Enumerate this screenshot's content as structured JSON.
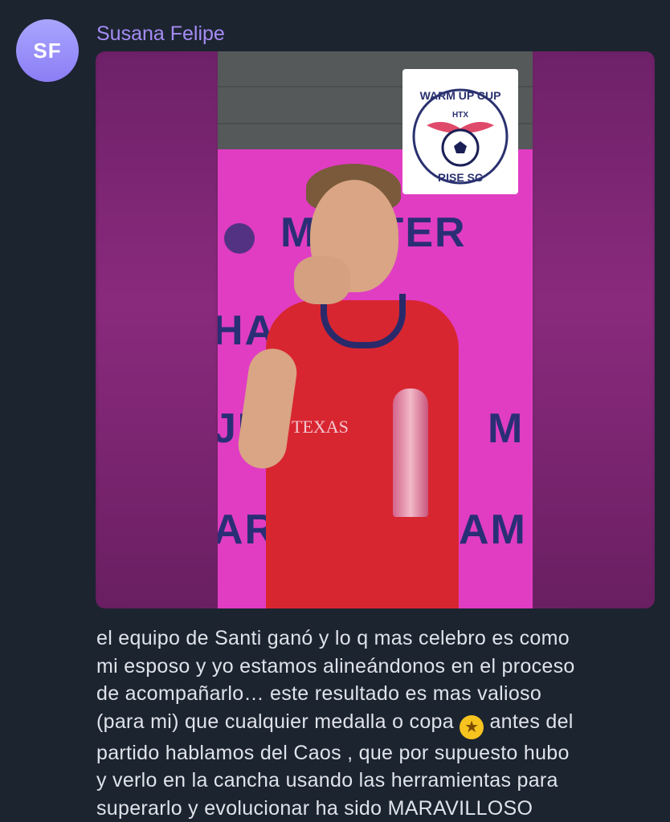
{
  "message": {
    "sender_initials": "SF",
    "sender_name": "Susana Felipe",
    "photo": {
      "logo_text_top": "WARM UP CUP",
      "logo_text_mid": "HTX",
      "logo_text_bottom": "RISE SC",
      "backdrop_words": [
        "MASTER",
        "HAMPIONS",
        "JU",
        "M",
        "AR",
        "AM"
      ],
      "sponsor_text": "TEXAS"
    },
    "text_line1": "el equipo de Santi ganó y lo q mas celebro es como",
    "text_line2": "mi esposo y yo estamos alineándonos en el proceso",
    "text_line3": "de acompañarlo… este resultado es mas valioso",
    "text_line4a": "(para mi) que cualquier medalla o copa",
    "emoji": "star-struck-emoji",
    "text_line4b": " antes del",
    "text_line5": "partido hablamos del Caos , que por supuesto hubo",
    "text_line6": "y verlo en la cancha usando las herramientas para",
    "text_line7": "superarlo y evolucionar ha sido MARAVILLOSO"
  },
  "colors": {
    "background": "#1c2430",
    "sender_name": "#a58cf5",
    "avatar": "#9b90fb",
    "text": "#dfe3ea"
  }
}
